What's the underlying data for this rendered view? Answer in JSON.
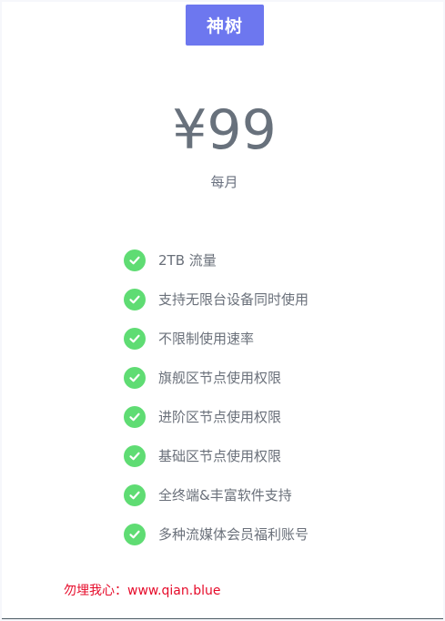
{
  "plan": {
    "name": "神树",
    "price": "¥99",
    "period": "每月"
  },
  "features": [
    "2TB 流量",
    "支持无限台设备同时使用",
    "不限制使用速率",
    "旗舰区节点使用权限",
    "进阶区节点使用权限",
    "基础区节点使用权限",
    "全终端&丰富软件支持",
    "多种流媒体会员福利账号"
  ],
  "footer": {
    "note": "勿埋我心：www.qian.blue"
  },
  "colors": {
    "accent": "#6d77ef",
    "check": "#5fdc73",
    "note": "#e60b2a"
  },
  "icons": {
    "feature": "check-circle-icon"
  }
}
